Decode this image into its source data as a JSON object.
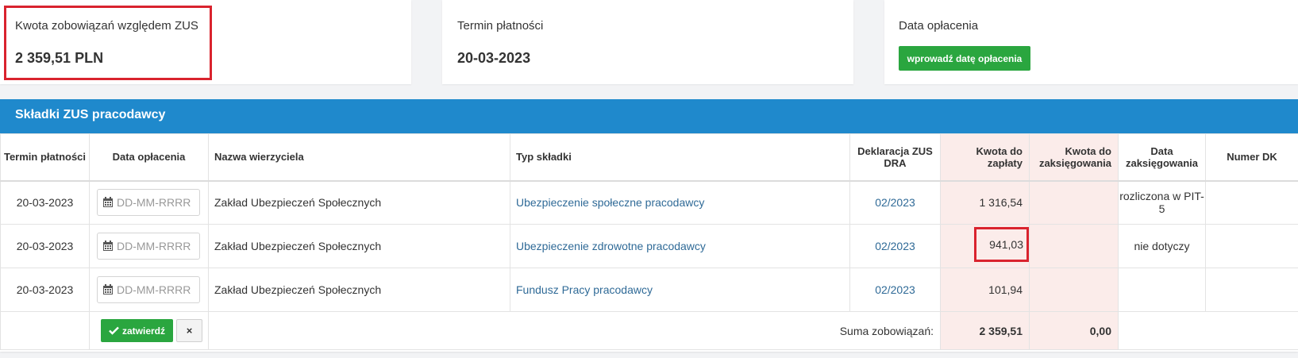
{
  "cards": {
    "amount": {
      "label": "Kwota zobowiązań względem ZUS",
      "value": "2 359,51 PLN"
    },
    "due": {
      "label": "Termin płatności",
      "value": "20-03-2023"
    },
    "paid": {
      "label": "Data opłacenia",
      "button": "wprowadź datę opłacenia"
    }
  },
  "panel": {
    "title": "Składki ZUS pracodawcy",
    "columns": {
      "due": "Termin płatności",
      "paid_date": "Data opłacenia",
      "creditor": "Nazwa wierzyciela",
      "type": "Typ składki",
      "declaration": "Deklaracja ZUS DRA",
      "to_pay": "Kwota do zapłaty",
      "to_book": "Kwota do zaksięgowania",
      "book_date": "Data zaksięgowania",
      "dk": "Numer DK"
    },
    "date_placeholder": "DD-MM-RRRR",
    "rows": [
      {
        "due": "20-03-2023",
        "creditor": "Zakład Ubezpieczeń Społecznych",
        "type": "Ubezpieczenie społeczne pracodawcy",
        "declaration": "02/2023",
        "to_pay": "1 316,54",
        "to_book": "",
        "book_date": "rozliczona w PIT-5",
        "dk": ""
      },
      {
        "due": "20-03-2023",
        "creditor": "Zakład Ubezpieczeń Społecznych",
        "type": "Ubezpieczenie zdrowotne pracodawcy",
        "declaration": "02/2023",
        "to_pay": "941,03",
        "to_book": "",
        "book_date": "nie dotyczy",
        "dk": ""
      },
      {
        "due": "20-03-2023",
        "creditor": "Zakład Ubezpieczeń Społecznych",
        "type": "Fundusz Pracy pracodawcy",
        "declaration": "02/2023",
        "to_pay": "101,94",
        "to_book": "",
        "book_date": "",
        "dk": ""
      }
    ],
    "footer": {
      "confirm": "zatwierdź",
      "cancel": "×",
      "sum_label": "Suma zobowiązań:",
      "sum_to_pay": "2 359,51",
      "sum_to_book": "0,00"
    }
  },
  "colors": {
    "header": "#1f89cc",
    "button": "#2aa63f",
    "highlight": "#d9232e",
    "amount_col": "#fbecea"
  }
}
